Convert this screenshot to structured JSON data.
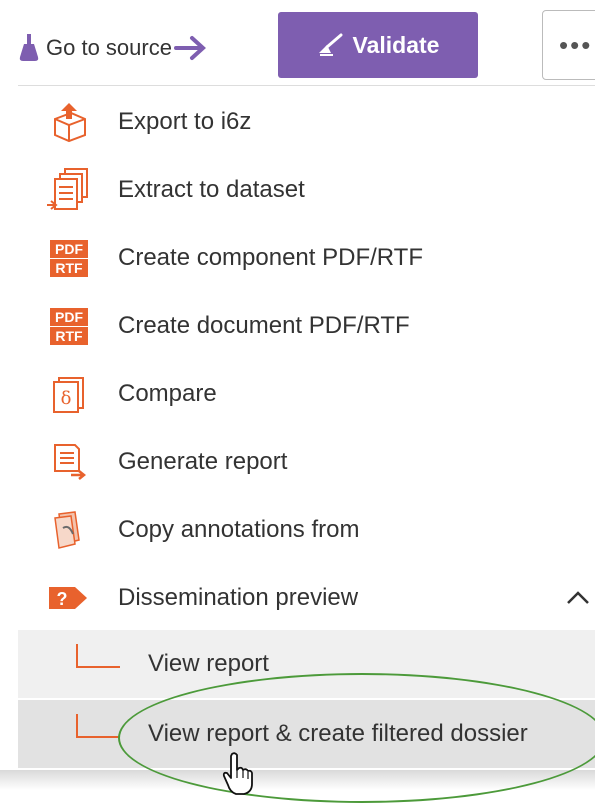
{
  "toolbar": {
    "goto_label": "Go to source",
    "validate_label": "Validate",
    "more_label": "•••"
  },
  "menu": {
    "items": [
      {
        "label": "Export to i6z",
        "icon": "export-box-icon"
      },
      {
        "label": "Extract to dataset",
        "icon": "extract-documents-icon"
      },
      {
        "label": "Create component PDF/RTF",
        "icon": "pdf-rtf-icon"
      },
      {
        "label": "Create document PDF/RTF",
        "icon": "pdf-rtf-icon"
      },
      {
        "label": "Compare",
        "icon": "compare-delta-icon"
      },
      {
        "label": "Generate report",
        "icon": "report-icon"
      },
      {
        "label": "Copy annotations from",
        "icon": "copy-annotations-icon"
      },
      {
        "label": "Dissemination preview",
        "icon": "dissemination-question-icon",
        "expanded": true
      }
    ],
    "subitems": [
      {
        "label": "View report"
      },
      {
        "label": "View report & create filtered dossier"
      }
    ]
  },
  "pdf_badge": {
    "top": "PDF",
    "bottom": "RTF"
  },
  "colors": {
    "accent_purple": "#7e5eb0",
    "icon_orange": "#e8622d",
    "highlight_green": "#4c9a3a"
  }
}
